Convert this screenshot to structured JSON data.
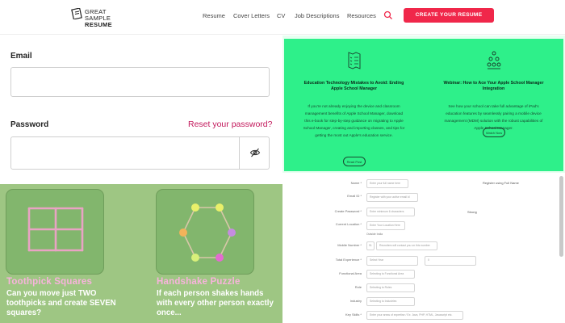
{
  "header": {
    "logo_line1": "GREAT",
    "logo_line2": "SAMPLE",
    "logo_line3": "RESUME",
    "nav": [
      "Resume",
      "Cover Letters",
      "CV",
      "Job Descriptions",
      "Resources"
    ],
    "cta": "CREATE YOUR RESUME"
  },
  "login": {
    "email_label": "Email",
    "password_label": "Password",
    "reset_link": "Reset your password?",
    "email_value": "",
    "password_value": ""
  },
  "cards": [
    {
      "title": "Education Technology Mistakes to Avoid: Ending Apple School Manager",
      "description": "If you're not already enjoying the device and classroom management benefits of Apple School Manager, download this e-book for step-by-step guidance on migrating to Apple School Manager, creating and importing classes, and tips for getting the most out Apple's education service.",
      "button": "Read Post"
    },
    {
      "title": "Webinar: How to Ace Your Apple School Manager Integration",
      "description": "See how your school can take full advantage of iPad's education features by seamlessly pairing a mobile device management (MDM) solution with the robust capabilities of Apple School Manager.",
      "button": "Watch Now"
    }
  ],
  "puzzles": [
    {
      "title": "Toothpick Squares",
      "description": "Can you move just TWO toothpicks and create SEVEN squares?"
    },
    {
      "title": "Handshake Puzzle",
      "description": "If each person shakes hands with every other person exactly once..."
    }
  ],
  "form": {
    "rows": [
      {
        "label": "Name *",
        "placeholder": "Enter your full name here"
      },
      {
        "label": "Email ID *",
        "placeholder": "Register with your active email id"
      },
      {
        "label": "Create Password *",
        "placeholder": "Enter minimum 6 characters"
      },
      {
        "label": "Current Location *",
        "placeholder": "Enter Your Location Here"
      },
      {
        "label": "Mobile Number *",
        "placeholder": "Recruiters will contact you on this number"
      },
      {
        "label": "Total Experience *",
        "placeholder": "Select Year"
      },
      {
        "label": "Functional Area",
        "placeholder": "Selecting to Functional Area"
      },
      {
        "label": "Role",
        "placeholder": "Selecting to Roles"
      },
      {
        "label": "Industry",
        "placeholder": "Selecting to Industries"
      },
      {
        "label": "Key Skills *",
        "placeholder": "Enter your areas of expertise / Ex: Java, PHP, HTML, Javascript etc."
      }
    ],
    "side_note1": "Register using Full Name",
    "side_note2": "Strong",
    "location_hint": "Outside India",
    "country_code": "91",
    "months_placeholder": "0"
  },
  "colors": {
    "cta": "#f0274a",
    "card_green": "#2ef08a",
    "puzzle_green": "#9ec683",
    "puzzle_title": "#f8b3dc",
    "reset_link": "#c2185b"
  }
}
